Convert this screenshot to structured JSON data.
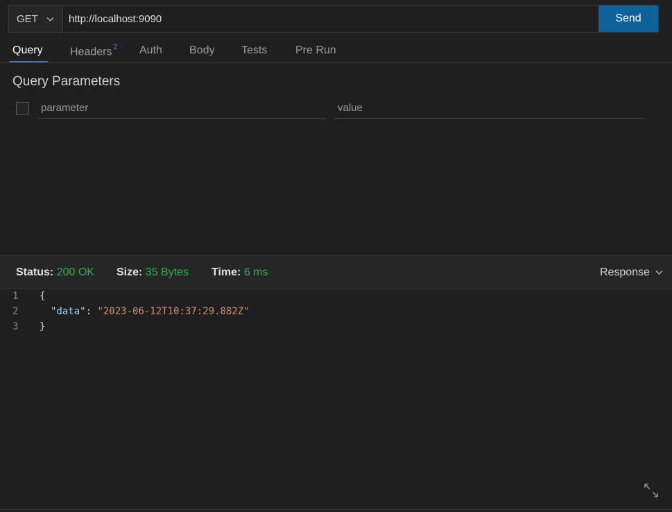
{
  "request": {
    "method": "GET",
    "url": "http://localhost:9090",
    "send_label": "Send"
  },
  "tabs": [
    {
      "label": "Query",
      "active": true
    },
    {
      "label": "Headers",
      "badge": "2"
    },
    {
      "label": "Auth"
    },
    {
      "label": "Body"
    },
    {
      "label": "Tests"
    },
    {
      "label": "Pre Run"
    }
  ],
  "query": {
    "title": "Query Parameters",
    "parameter_placeholder": "parameter",
    "value_placeholder": "value"
  },
  "status": {
    "status_label": "Status:",
    "status_value": "200 OK",
    "size_label": "Size:",
    "size_value": "35 Bytes",
    "time_label": "Time:",
    "time_value": "6 ms",
    "view_selector": "Response"
  },
  "response": {
    "lines": [
      {
        "number": "1",
        "text": "{"
      },
      {
        "number": "2",
        "key": "\"data\"",
        "sep": ": ",
        "value": "\"2023-06-12T10:37:29.882Z\""
      },
      {
        "number": "3",
        "text": "}"
      }
    ]
  },
  "colors": {
    "accent": "#0e639c",
    "status_ok": "#2fb24c",
    "json_key": "#9cdcfe",
    "json_string": "#ce9178"
  },
  "icons": [
    "chevron-down-icon",
    "expand-icon"
  ]
}
